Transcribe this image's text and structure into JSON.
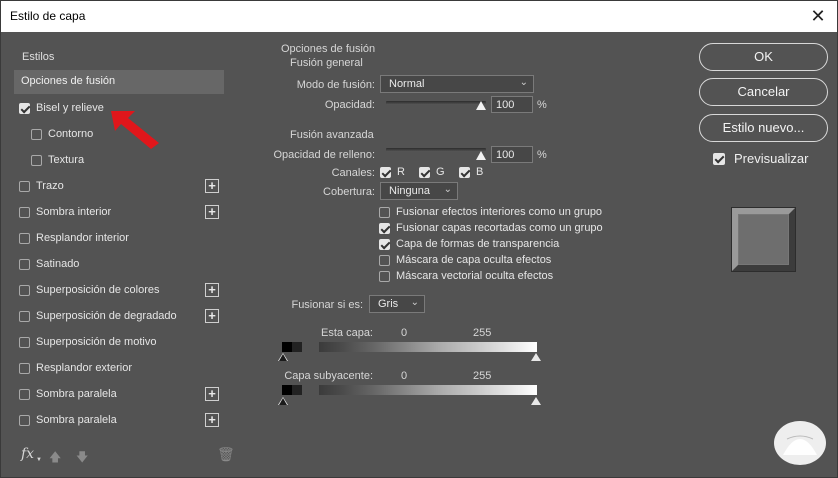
{
  "window": {
    "title": "Estilo de capa"
  },
  "left": {
    "heading": "Estilos",
    "selected": "Opciones de fusión",
    "items": [
      {
        "label": "Bisel y relieve",
        "checked": true,
        "sub": false,
        "plus": false
      },
      {
        "label": "Contorno",
        "checked": false,
        "sub": true,
        "plus": false
      },
      {
        "label": "Textura",
        "checked": false,
        "sub": true,
        "plus": false
      },
      {
        "label": "Trazo",
        "checked": false,
        "sub": false,
        "plus": true
      },
      {
        "label": "Sombra interior",
        "checked": false,
        "sub": false,
        "plus": true
      },
      {
        "label": "Resplandor interior",
        "checked": false,
        "sub": false,
        "plus": false
      },
      {
        "label": "Satinado",
        "checked": false,
        "sub": false,
        "plus": false
      },
      {
        "label": "Superposición de colores",
        "checked": false,
        "sub": false,
        "plus": true
      },
      {
        "label": "Superposición de degradado",
        "checked": false,
        "sub": false,
        "plus": true
      },
      {
        "label": "Superposición de motivo",
        "checked": false,
        "sub": false,
        "plus": false
      },
      {
        "label": "Resplandor exterior",
        "checked": false,
        "sub": false,
        "plus": false
      },
      {
        "label": "Sombra paralela",
        "checked": false,
        "sub": false,
        "plus": true
      },
      {
        "label": "Sombra paralela",
        "checked": false,
        "sub": false,
        "plus": true
      }
    ],
    "fx_label": "fx"
  },
  "middle": {
    "section_title": "Opciones de fusión",
    "general_title": "Fusión general",
    "mode_label": "Modo de fusión:",
    "mode_value": "Normal",
    "opacity_label": "Opacidad:",
    "opacity_value": "100",
    "opacity_unit": "%",
    "advanced_title": "Fusión avanzada",
    "fill_label": "Opacidad de relleno:",
    "fill_value": "100",
    "fill_unit": "%",
    "channels_label": "Canales:",
    "channels": [
      {
        "label": "R",
        "checked": true
      },
      {
        "label": "G",
        "checked": true
      },
      {
        "label": "B",
        "checked": true
      }
    ],
    "knockout_label": "Cobertura:",
    "knockout_value": "Ninguna",
    "options": [
      {
        "label": "Fusionar efectos interiores como un grupo",
        "checked": false
      },
      {
        "label": "Fusionar capas recortadas como un grupo",
        "checked": true
      },
      {
        "label": "Capa de formas de transparencia",
        "checked": true
      },
      {
        "label": "Máscara de capa oculta efectos",
        "checked": false
      },
      {
        "label": "Máscara vectorial oculta efectos",
        "checked": false
      }
    ],
    "blendif_label": "Fusionar si es:",
    "blendif_value": "Gris",
    "this_layer_label": "Esta capa:",
    "this_layer_min": "0",
    "this_layer_max": "255",
    "underlying_label": "Capa subyacente:",
    "underlying_min": "0",
    "underlying_max": "255"
  },
  "right": {
    "ok": "OK",
    "cancel": "Cancelar",
    "new_style": "Estilo nuevo...",
    "preview_label": "Previsualizar",
    "preview_checked": true
  },
  "colors": {
    "bg": "#535353",
    "selected": "#676767",
    "arrow": "#e0161b"
  }
}
